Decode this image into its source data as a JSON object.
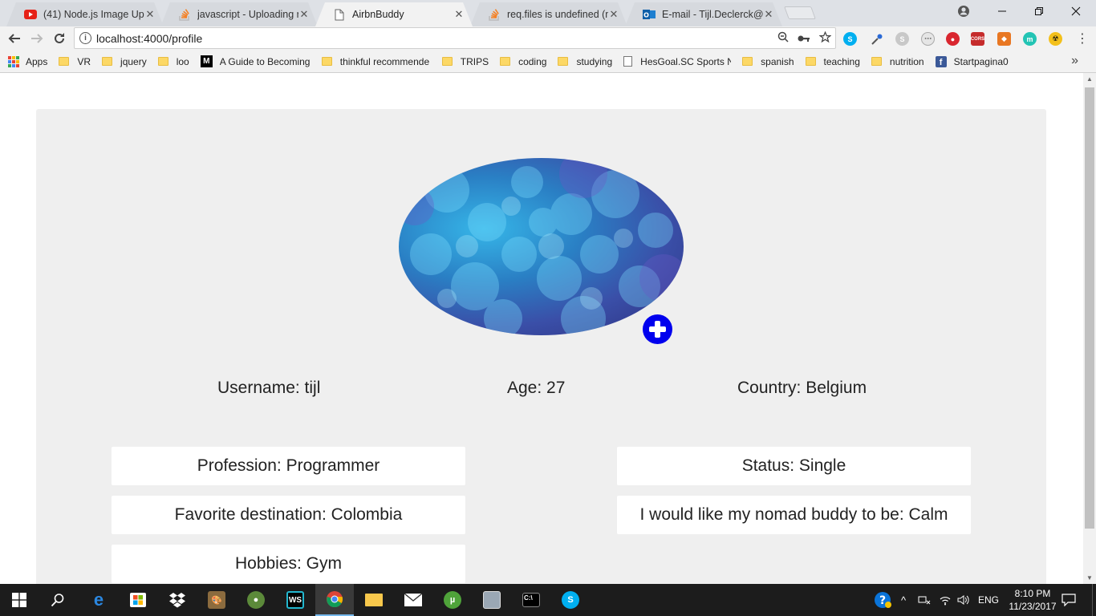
{
  "browser": {
    "tabs": [
      {
        "title": "(41) Node.js Image Uplo",
        "favicon": "youtube-icon",
        "active": false
      },
      {
        "title": "javascript - Uploading m",
        "favicon": "stackoverflow-icon",
        "active": false
      },
      {
        "title": "AirbnBuddy",
        "favicon": "page-icon",
        "active": true
      },
      {
        "title": "req.files is undefined (mu",
        "favicon": "stackoverflow-icon",
        "active": false
      },
      {
        "title": "E-mail - Tijl.Declerck@ou",
        "favicon": "outlook-icon",
        "active": false
      }
    ],
    "url": "localhost:4000/profile",
    "bookmarks": [
      {
        "label": "Apps",
        "icon": "apps-grid-icon"
      },
      {
        "label": "VR",
        "icon": "folder-icon"
      },
      {
        "label": "jquery",
        "icon": "folder-icon"
      },
      {
        "label": "loo",
        "icon": "folder-icon"
      },
      {
        "label": "A Guide to Becoming",
        "icon": "medium-icon"
      },
      {
        "label": "thinkful recommende",
        "icon": "folder-icon"
      },
      {
        "label": "TRIPS",
        "icon": "folder-icon"
      },
      {
        "label": "coding",
        "icon": "folder-icon"
      },
      {
        "label": "studying",
        "icon": "folder-icon"
      },
      {
        "label": "HesGoal.SC Sports N",
        "icon": "page-icon"
      },
      {
        "label": "spanish",
        "icon": "folder-icon"
      },
      {
        "label": "teaching",
        "icon": "folder-icon"
      },
      {
        "label": "nutrition",
        "icon": "folder-icon"
      },
      {
        "label": "Startpagina0",
        "icon": "facebook-icon"
      }
    ]
  },
  "profile": {
    "username": "Username: tijl",
    "age": "Age: 27",
    "country": "Country: Belgium",
    "profession": "Profession: Programmer",
    "status": "Status: Single",
    "favorite_destination": "Favorite destination: Colombia",
    "buddy_preference": "I would like my nomad buddy to be: Calm",
    "hobbies": "Hobbies: Gym"
  },
  "taskbar": {
    "language": "ENG",
    "time": "8:10 PM",
    "date": "11/23/2017"
  },
  "colors": {
    "add_button": "#0000ee",
    "card_background": "#efefef",
    "taskbar": "#1c1c1c"
  }
}
